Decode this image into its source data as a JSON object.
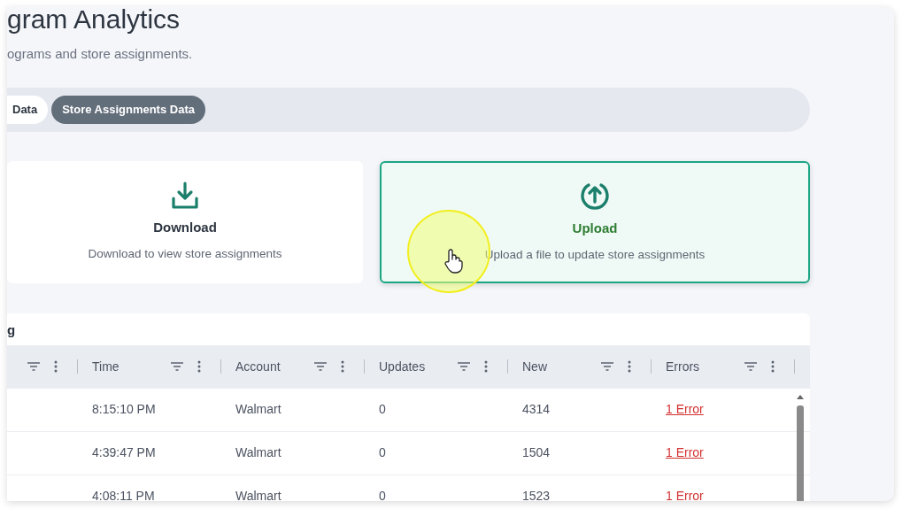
{
  "page": {
    "title": "gram Analytics",
    "subtitle": "ograms and store assignments."
  },
  "tabs": [
    {
      "label": "Data",
      "selected": false
    },
    {
      "label": "Store Assignments Data",
      "selected": true
    }
  ],
  "actions": [
    {
      "kind": "download",
      "title": "Download",
      "description": "Download to view store assignments",
      "selected": false
    },
    {
      "kind": "upload",
      "title": "Upload",
      "description": "Upload a file to update store assignments",
      "selected": true
    }
  ],
  "table": {
    "title": "g",
    "columns": [
      {
        "kind": "text",
        "label": "Time"
      },
      {
        "kind": "text",
        "label": "Account"
      },
      {
        "kind": "text",
        "label": "Updates"
      },
      {
        "kind": "text",
        "label": "New"
      },
      {
        "kind": "link",
        "label": "Errors"
      }
    ],
    "rows": [
      {
        "cells": [
          "8:15:10 PM",
          "Walmart",
          "0",
          "4314",
          "1 Error"
        ]
      },
      {
        "cells": [
          "4:39:47 PM",
          "Walmart",
          "0",
          "1504",
          "1 Error"
        ]
      },
      {
        "cells": [
          "4:08:11 PM",
          "Walmart",
          "0",
          "1523",
          "1 Error"
        ]
      }
    ]
  }
}
